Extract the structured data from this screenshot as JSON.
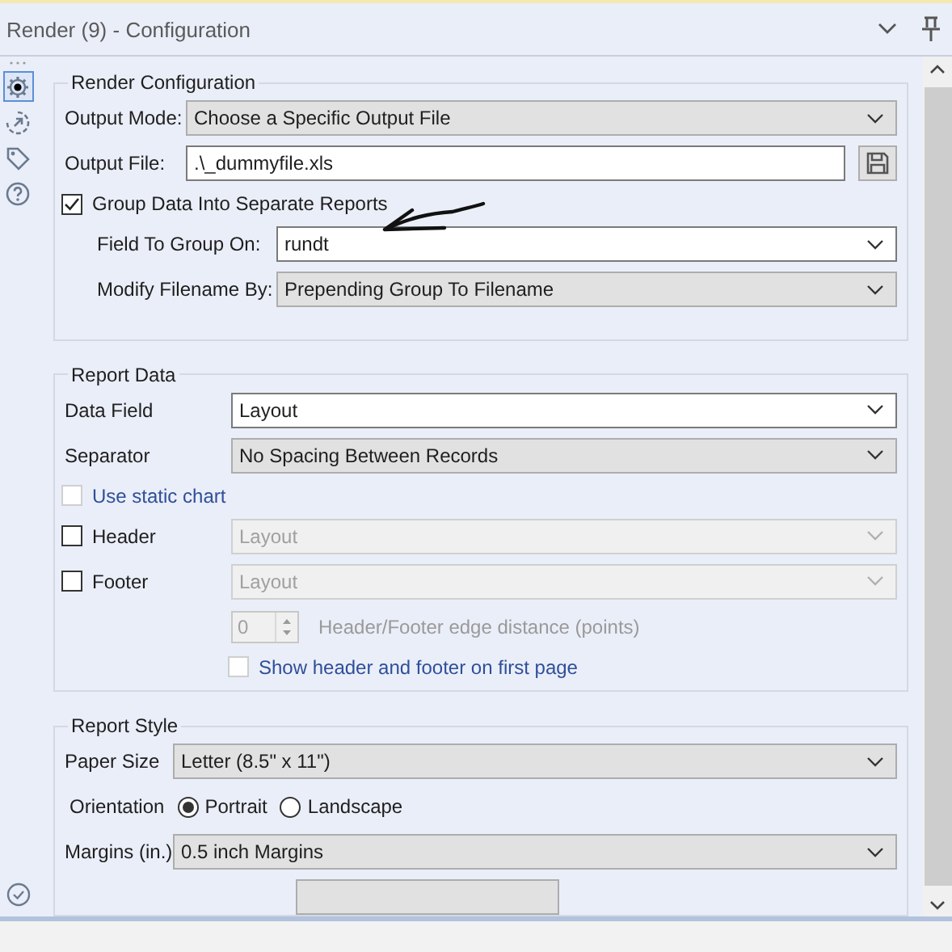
{
  "window": {
    "title": "Render (9) - Configuration"
  },
  "sidebar": [
    {
      "kind": "gear",
      "selected": true
    },
    {
      "kind": "arrow",
      "selected": false
    },
    {
      "kind": "tag",
      "selected": false
    },
    {
      "kind": "help",
      "selected": false
    }
  ],
  "sections": [
    {
      "title": "Render Configuration",
      "rows": [
        {
          "kind": "dropdown",
          "label": "Output Mode:",
          "value": "Choose a Specific Output File",
          "disabled": false
        },
        {
          "kind": "file",
          "label": "Output File:",
          "value": ".\\_dummyfile.xls"
        },
        {
          "kind": "checkbox",
          "label": "Group Data Into Separate Reports",
          "checked": true,
          "disabled": false,
          "children": [
            {
              "kind": "combo",
              "label": "Field To Group On:",
              "value": "rundt",
              "disabled": false
            },
            {
              "kind": "dropdown",
              "label": "Modify Filename By:",
              "value": "Prepending Group To Filename",
              "disabled": false
            }
          ]
        }
      ]
    },
    {
      "title": "Report Data",
      "rows": [
        {
          "kind": "combo",
          "label": "Data Field",
          "value": "Layout",
          "disabled": false
        },
        {
          "kind": "dropdown",
          "label": "Separator",
          "value": "No Spacing Between Records",
          "disabled": false
        },
        {
          "kind": "checkbox",
          "label": "Use static chart",
          "checked": false,
          "disabled": true
        },
        {
          "kind": "checkbox",
          "label": "Header",
          "checked": false,
          "disabled": false,
          "select": {
            "value": "Layout",
            "disabled": true
          }
        },
        {
          "kind": "checkbox",
          "label": "Footer",
          "checked": false,
          "disabled": false,
          "select": {
            "value": "Layout",
            "disabled": true
          },
          "children": [
            {
              "kind": "spinner",
              "value": "0",
              "caption": "Header/Footer edge distance (points)",
              "disabled": true
            },
            {
              "kind": "checkbox",
              "label": "Show header and footer on first page",
              "checked": false,
              "disabled": true
            }
          ]
        }
      ]
    },
    {
      "title": "Report Style",
      "rows": [
        {
          "kind": "dropdown",
          "label": "Paper Size",
          "value": "Letter (8.5\" x 11\")",
          "disabled": false
        },
        {
          "kind": "radio",
          "label": "Orientation",
          "options": [
            {
              "label": "Portrait",
              "selected": true
            },
            {
              "label": "Landscape",
              "selected": false
            }
          ]
        },
        {
          "kind": "dropdown",
          "label": "Margins (in.)",
          "value": "0.5 inch Margins",
          "disabled": false
        },
        {
          "kind": "button"
        }
      ]
    }
  ]
}
